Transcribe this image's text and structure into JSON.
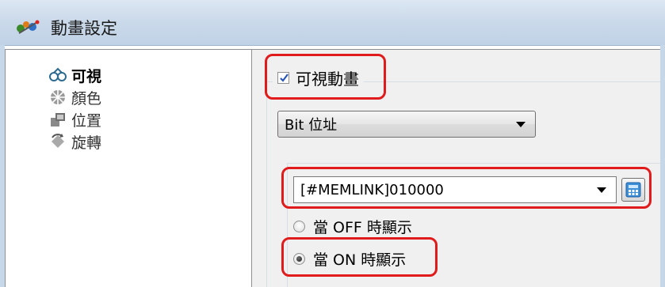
{
  "window": {
    "title": "動畫設定",
    "icon": "animation-settings-icon"
  },
  "nav": {
    "items": [
      {
        "label": "可視",
        "icon": "visibility-glasses-icon",
        "active": true
      },
      {
        "label": "顏色",
        "icon": "color-wheel-icon",
        "active": false
      },
      {
        "label": "位置",
        "icon": "position-icon",
        "active": false
      },
      {
        "label": "旋轉",
        "icon": "rotate-icon",
        "active": false
      }
    ]
  },
  "visibility": {
    "checkbox_label": "可視動畫",
    "checked": true,
    "address_type": "Bit 位址",
    "address_value": "[#MEMLINK]010000",
    "radio_off_label": "當 OFF 時顯示",
    "radio_on_label": "當 ON 時顯示",
    "selected_radio": "on"
  },
  "colors": {
    "highlight": "#e01b1b",
    "check": "#2a56b8"
  }
}
